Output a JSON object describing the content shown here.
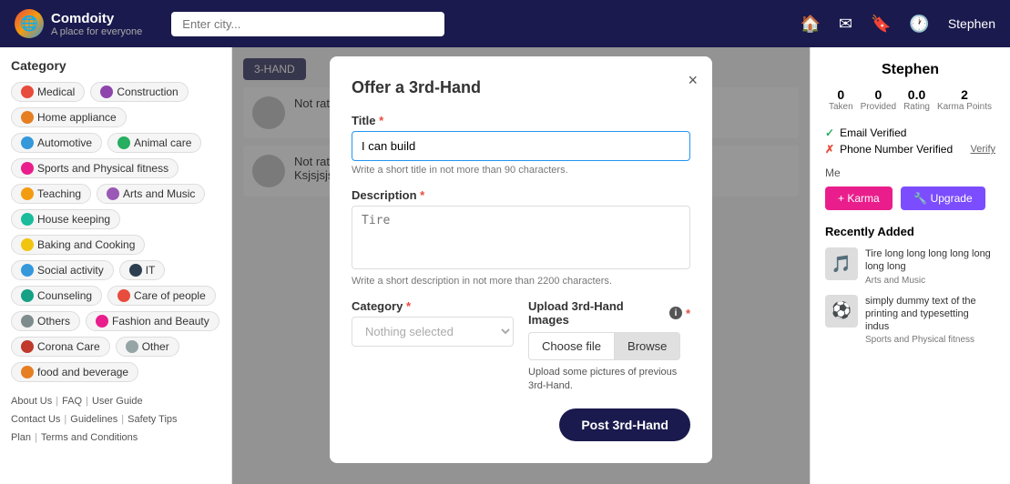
{
  "app": {
    "brand": "Comdoity",
    "tagline": "A place for everyone"
  },
  "header": {
    "search_placeholder": "Enter city...",
    "user": "Stephen",
    "icons": [
      "home",
      "mail",
      "bookmark",
      "history"
    ]
  },
  "sidebar": {
    "title": "Category",
    "categories": [
      {
        "label": "Medical",
        "color": "#e74c3c"
      },
      {
        "label": "Construction",
        "color": "#8e44ad"
      },
      {
        "label": "Home appliance",
        "color": "#e67e22"
      },
      {
        "label": "Automotive",
        "color": "#3498db"
      },
      {
        "label": "Animal care",
        "color": "#27ae60"
      },
      {
        "label": "Sports and Physical fitness",
        "color": "#e91e8c"
      },
      {
        "label": "Teaching",
        "color": "#f39c12"
      },
      {
        "label": "Arts and Music",
        "color": "#9b59b6"
      },
      {
        "label": "House keeping",
        "color": "#1abc9c"
      },
      {
        "label": "Baking and Cooking",
        "color": "#f1c40f"
      },
      {
        "label": "Social activity",
        "color": "#3498db"
      },
      {
        "label": "IT",
        "color": "#2c3e50"
      },
      {
        "label": "Counseling",
        "color": "#16a085"
      },
      {
        "label": "Care of people",
        "color": "#e74c3c"
      },
      {
        "label": "Others",
        "color": "#7f8c8d"
      },
      {
        "label": "Fashion and Beauty",
        "color": "#e91e8c"
      },
      {
        "label": "Corona Care",
        "color": "#c0392b"
      },
      {
        "label": "Other",
        "color": "#95a5a6"
      },
      {
        "label": "food and beverage",
        "color": "#e67e22"
      }
    ],
    "footer": {
      "links": [
        "About Us",
        "FAQ",
        "User Guide",
        "Contact Us",
        "Guidelines",
        "Safety Tips",
        "Plan",
        "Terms and Conditions"
      ]
    }
  },
  "modal": {
    "title": "Offer a 3rd-Hand",
    "close_label": "×",
    "title_label": "Title",
    "title_placeholder": "I can build",
    "title_hint": "Write a short title in not more than 90 characters.",
    "description_label": "Description",
    "description_hint": "Write a short description in not more than 2200 characters.",
    "description_placeholder": "Tire",
    "category_label": "Category",
    "category_placeholder": "Nothing selected",
    "upload_label": "Upload 3rd-Hand Images",
    "choose_file_label": "Choose file",
    "browse_label": "Browse",
    "upload_hint": "Upload some pictures of previous 3rd-Hand.",
    "post_button": "Post 3rd-Hand",
    "required_marker": "*"
  },
  "right_panel": {
    "user_name": "Stephen",
    "stats": [
      {
        "label": "Taken",
        "value": "0"
      },
      {
        "label": "Provided",
        "value": "0"
      },
      {
        "label": "Rating",
        "value": "0.0"
      },
      {
        "label": "Karma Points",
        "value": "2"
      }
    ],
    "email_verified": "Email Verified",
    "phone_verified": "Phone Number Verified",
    "verify_link": "Verify",
    "me_label": "Me",
    "karma_btn": "+ Karma",
    "upgrade_btn": "🔧 Upgrade",
    "recently_added_title": "Recently Added",
    "recent_items": [
      {
        "title": "Tire long long long long long long long",
        "category": "Arts and Music",
        "emoji": "🎵"
      },
      {
        "title": "simply dummy text of the printing and typesetting indus",
        "category": "Sports and Physical fitness",
        "emoji": "⚽"
      }
    ]
  },
  "background": {
    "third_hand_btn": "3-HAND",
    "list_items": [
      {
        "text": "Not rated",
        "sub": ""
      },
      {
        "text": "Not rated",
        "sub": "Ksjsjsjsjsjs"
      }
    ]
  }
}
